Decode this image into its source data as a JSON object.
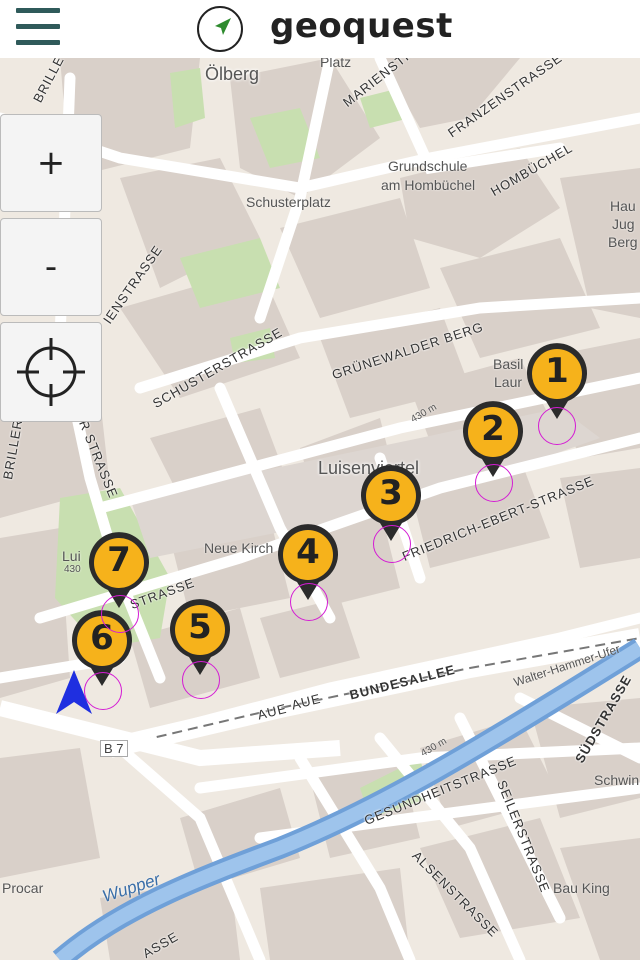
{
  "header": {
    "menu_icon": "hamburger-menu-icon",
    "logo_icon": "compass-arrow-icon",
    "title": "geoquest",
    "accent": "#2f5a5a"
  },
  "controls": {
    "zoom_in": "+",
    "zoom_out": "-",
    "locate_icon": "crosshair-icon"
  },
  "markers": [
    {
      "label": "1"
    },
    {
      "label": "2"
    },
    {
      "label": "3"
    },
    {
      "label": "4"
    },
    {
      "label": "5"
    },
    {
      "label": "6"
    },
    {
      "label": "7"
    }
  ],
  "marker_color": "#f6b21b",
  "ring_color": "#d41cd4",
  "location_icon": "navigation-arrow-icon",
  "map_labels": {
    "olberg": "Ölberg",
    "platz": "Platz",
    "marienstrasse": "MARIENSTRASSE",
    "franzenstrasse": "FRANZENSTRASSE",
    "briller_top": "BRILLE",
    "grundschule": "Grundschule",
    "am_hombuchel": "am Hombüchel",
    "hombuchel": "HOMBÜCHEL",
    "hau": "Hau",
    "jug": "Jug",
    "berg": "Berg",
    "schusterplatz": "Schusterplatz",
    "ienstrasse": "IENSTRASSE",
    "schusterstrasse": "SCHUSTERSTRASSE",
    "grunewalder": "GRÜNEWALDER BERG",
    "basil": "Basil",
    "laur": "Laur",
    "elev430a": "430 m",
    "briller_left": "BRILLER",
    "r_strasse": "R STRASSE",
    "luisenviertel": "Luisenviertel",
    "friedrich": "FRIEDRICH-EBERT-STRASSE",
    "neue_kirche": "Neue Kirch",
    "lui": "Lui",
    "elev430b": "430",
    "strasse_small": "STRASSE",
    "aue1": "AUE",
    "aue2": "AUE",
    "bundesallee": "BUNDESALLEE",
    "walter": "Walter-Hammer-Ufer",
    "sudstrasse": "SÜDSTRASSE",
    "b7": "B 7",
    "elev430c": "430 m",
    "gesundheit": "GESUNDHEITSTRASSE",
    "seiler": "SEILERSTRASSE",
    "schwin": "Schwin",
    "wupper": "Wupper",
    "alsen": "ALSENSTRASSE",
    "procar": "Procar",
    "bau_king": "Bau King",
    "asse": "ASSE"
  }
}
